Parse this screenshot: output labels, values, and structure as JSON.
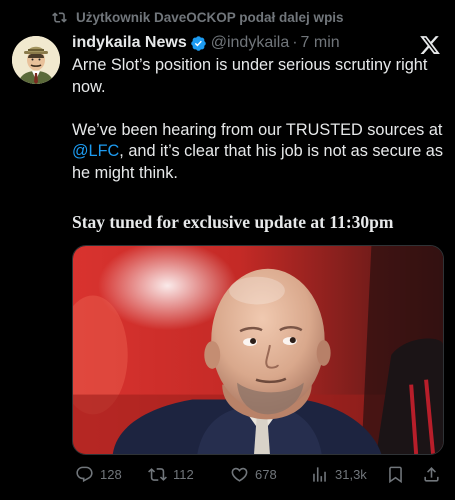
{
  "repost": {
    "icon": "repost-icon",
    "text": "Użytkownik DaveOCKOP podał dalej wpis"
  },
  "author": {
    "name": "indykaila News",
    "handle": "@indykaila",
    "separator": "·",
    "time": "7 min",
    "verified_color": "#1d9bf0"
  },
  "tweet": {
    "line1": "Arne Slot’s position is under serious scrutiny right now.",
    "p2_before": "We’ve been hearing from our TRUSTED sources at ",
    "mention": "@LFC",
    "p2_after": ", and it’s clear that his job is not as secure as he might think.",
    "headline": "Stay tuned for exclusive update at 11:30pm"
  },
  "actions": {
    "replies": "128",
    "reposts": "112",
    "likes": "678",
    "views": "31,3k"
  },
  "colors": {
    "background": "#000000",
    "text": "#e7e9ea",
    "muted": "#71767b",
    "accent": "#1d9bf0"
  }
}
